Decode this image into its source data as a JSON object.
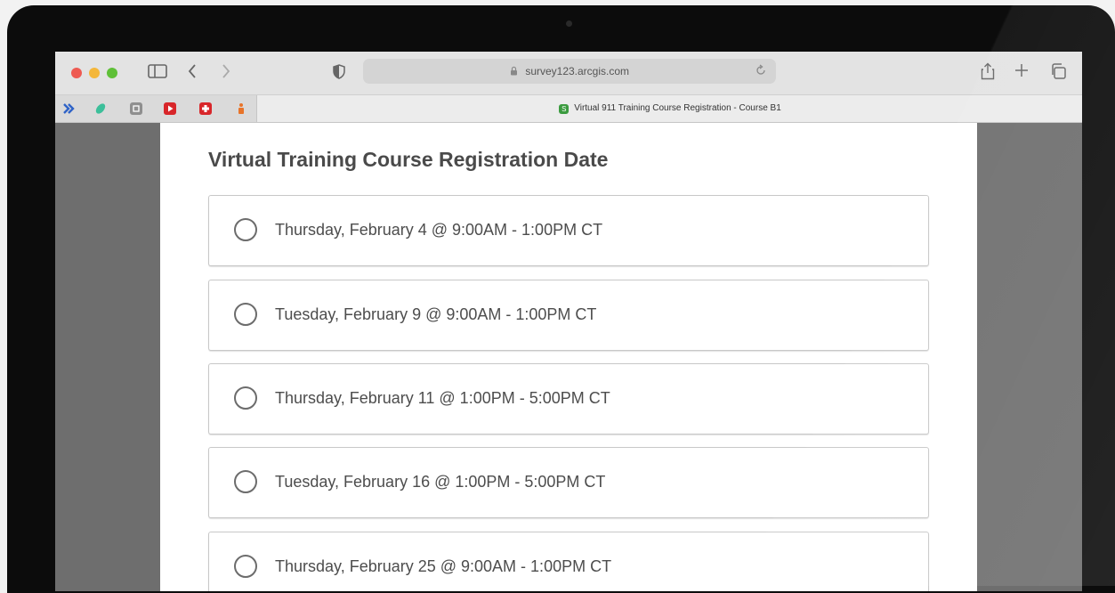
{
  "browser": {
    "url": "survey123.arcgis.com",
    "tab_title": "Virtual 911 Training Course Registration - Course B1",
    "traffic_lights": [
      "#ee5a52",
      "#f4b73a",
      "#5fc038"
    ],
    "extensions": [
      "ext-blue-arrow",
      "ext-green-leaf",
      "ext-gray-square",
      "ext-red-play",
      "ext-red-cross",
      "ext-orange-person"
    ]
  },
  "page": {
    "title": "Virtual Training Course Registration Date",
    "options": [
      {
        "label": "Thursday, February 4 @ 9:00AM - 1:00PM CT",
        "selected": false
      },
      {
        "label": "Tuesday, February 9 @ 9:00AM - 1:00PM CT",
        "selected": false
      },
      {
        "label": "Thursday, February 11 @ 1:00PM - 5:00PM CT",
        "selected": false
      },
      {
        "label": "Tuesday, February 16 @ 1:00PM - 5:00PM CT",
        "selected": false
      },
      {
        "label": "Thursday, February 25 @ 9:00AM - 1:00PM CT",
        "selected": false
      }
    ]
  }
}
